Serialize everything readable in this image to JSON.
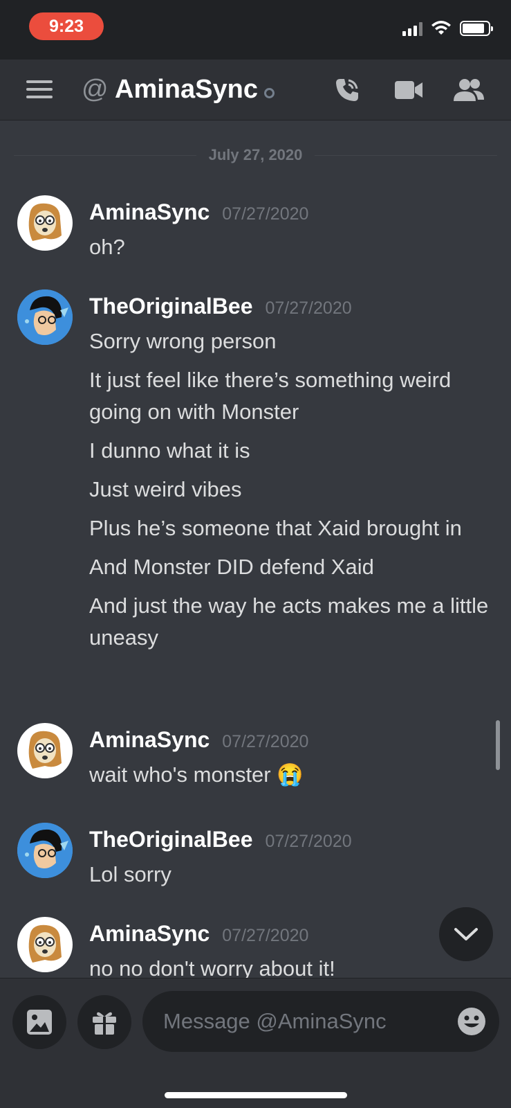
{
  "status_bar": {
    "time": "9:23"
  },
  "header": {
    "title": "AminaSync",
    "icons": [
      "menu-icon",
      "at-icon",
      "phone-call-icon",
      "video-call-icon",
      "members-icon"
    ]
  },
  "date_divider": "July 27, 2020",
  "messages": [
    {
      "author": "AminaSync",
      "timestamp": "07/27/2020",
      "lines": [
        "oh?"
      ]
    },
    {
      "author": "TheOriginalBee",
      "timestamp": "07/27/2020",
      "lines": [
        "Sorry wrong person",
        "It just feel like there’s something weird going on with Monster",
        "I dunno what it is",
        "Just weird vibes",
        "Plus he’s someone that Xaid brought in",
        "And Monster DID defend Xaid",
        "And just the way he acts makes me a little uneasy"
      ]
    },
    {
      "author": "AminaSync",
      "timestamp": "07/27/2020",
      "lines": [
        "wait who's monster 😭"
      ]
    },
    {
      "author": "TheOriginalBee",
      "timestamp": "07/27/2020",
      "lines": [
        "Lol sorry"
      ]
    },
    {
      "author": "AminaSync",
      "timestamp": "07/27/2020",
      "lines": [
        "no no don't worry about it!"
      ]
    }
  ],
  "composer": {
    "placeholder": "Message @AminaSync",
    "icons": [
      "image-icon",
      "gift-icon",
      "emoji-icon"
    ]
  },
  "colors": {
    "background": "#36393f",
    "header": "#2f3136",
    "status_pill": "#eb4d3d"
  }
}
